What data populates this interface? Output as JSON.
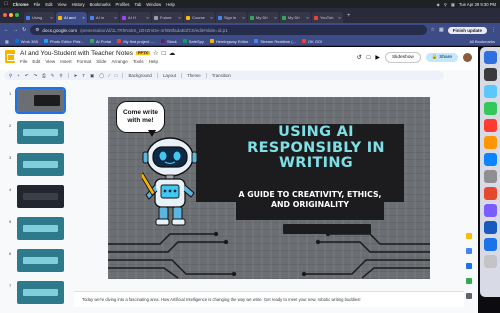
{
  "menubar": {
    "app": "Chrome",
    "items": [
      "File",
      "Edit",
      "View",
      "History",
      "Bookmarks",
      "Profiles",
      "Tab",
      "Window",
      "Help"
    ],
    "clock": "Tue Apr 29  9:30 PM"
  },
  "tabs": [
    {
      "label": "Using",
      "color": "#4285f4"
    },
    {
      "label": "AI and",
      "color": "#fbbc04",
      "active": true
    },
    {
      "label": "AI in",
      "color": "#4285f4"
    },
    {
      "label": "AI H",
      "color": "#a142f4"
    },
    {
      "label": "Future",
      "color": "#9aa0a6"
    },
    {
      "label": "Course",
      "color": "#fbbc04"
    },
    {
      "label": "Sign in",
      "color": "#4285f4"
    },
    {
      "label": "My Dri",
      "color": "#34a853"
    },
    {
      "label": "My Dri",
      "color": "#34a853"
    },
    {
      "label": "YouTub",
      "color": "#ea4335"
    }
  ],
  "toolbar": {
    "domain": "docs.google.com",
    "path": "/presentation/d/1L7RhNokS_tZHZmDe-4rhB8fadaB1fC0/edit#slide=id.p1",
    "finish_label": "Finish update"
  },
  "bookmarks": [
    {
      "label": "Work 365",
      "color": "#0078d4"
    },
    {
      "label": "Photo Editor Pixlr...",
      "color": "#1fa1ff"
    },
    {
      "label": "AI Portal",
      "color": "#34a853"
    },
    {
      "label": "My first project -...",
      "color": "#ea4335"
    },
    {
      "label": "Slack",
      "color": "#611f69"
    },
    {
      "label": "SafeSpy",
      "color": "#0f9d58"
    },
    {
      "label": "Hemingway Editor",
      "color": "#f4b400"
    },
    {
      "label": "Stream Realtime (...",
      "color": "#4285f4"
    },
    {
      "label": "OK GO!",
      "color": "#ea4335"
    }
  ],
  "bookmarks_all": "All Bookmarks",
  "slides": {
    "title": "AI and You-Student with Teacher Notes",
    "badge": "PPTX",
    "menu": [
      "File",
      "Edit",
      "View",
      "Insert",
      "Format",
      "Slide",
      "Arrange",
      "Tools",
      "Help"
    ],
    "slideshow_label": "Slideshow",
    "share_label": "Share",
    "format_tools": [
      "Background",
      "Layout",
      "Theme",
      "Transition"
    ],
    "thumbnail_numbers": [
      "1",
      "2",
      "3",
      "4",
      "5",
      "6",
      "7"
    ],
    "notes": "Today we're diving into a fascinating area: How Artificial Intelligence is changing the way we write. Get ready to meet your new, robotic writing buddies!"
  },
  "slide_content": {
    "bubble": "Come write with me!",
    "title": "USING AI RESPONSIBLY IN WRITING",
    "subtitle": "A GUIDE TO CREATIVITY, ETHICS, AND ORIGINALITY"
  }
}
